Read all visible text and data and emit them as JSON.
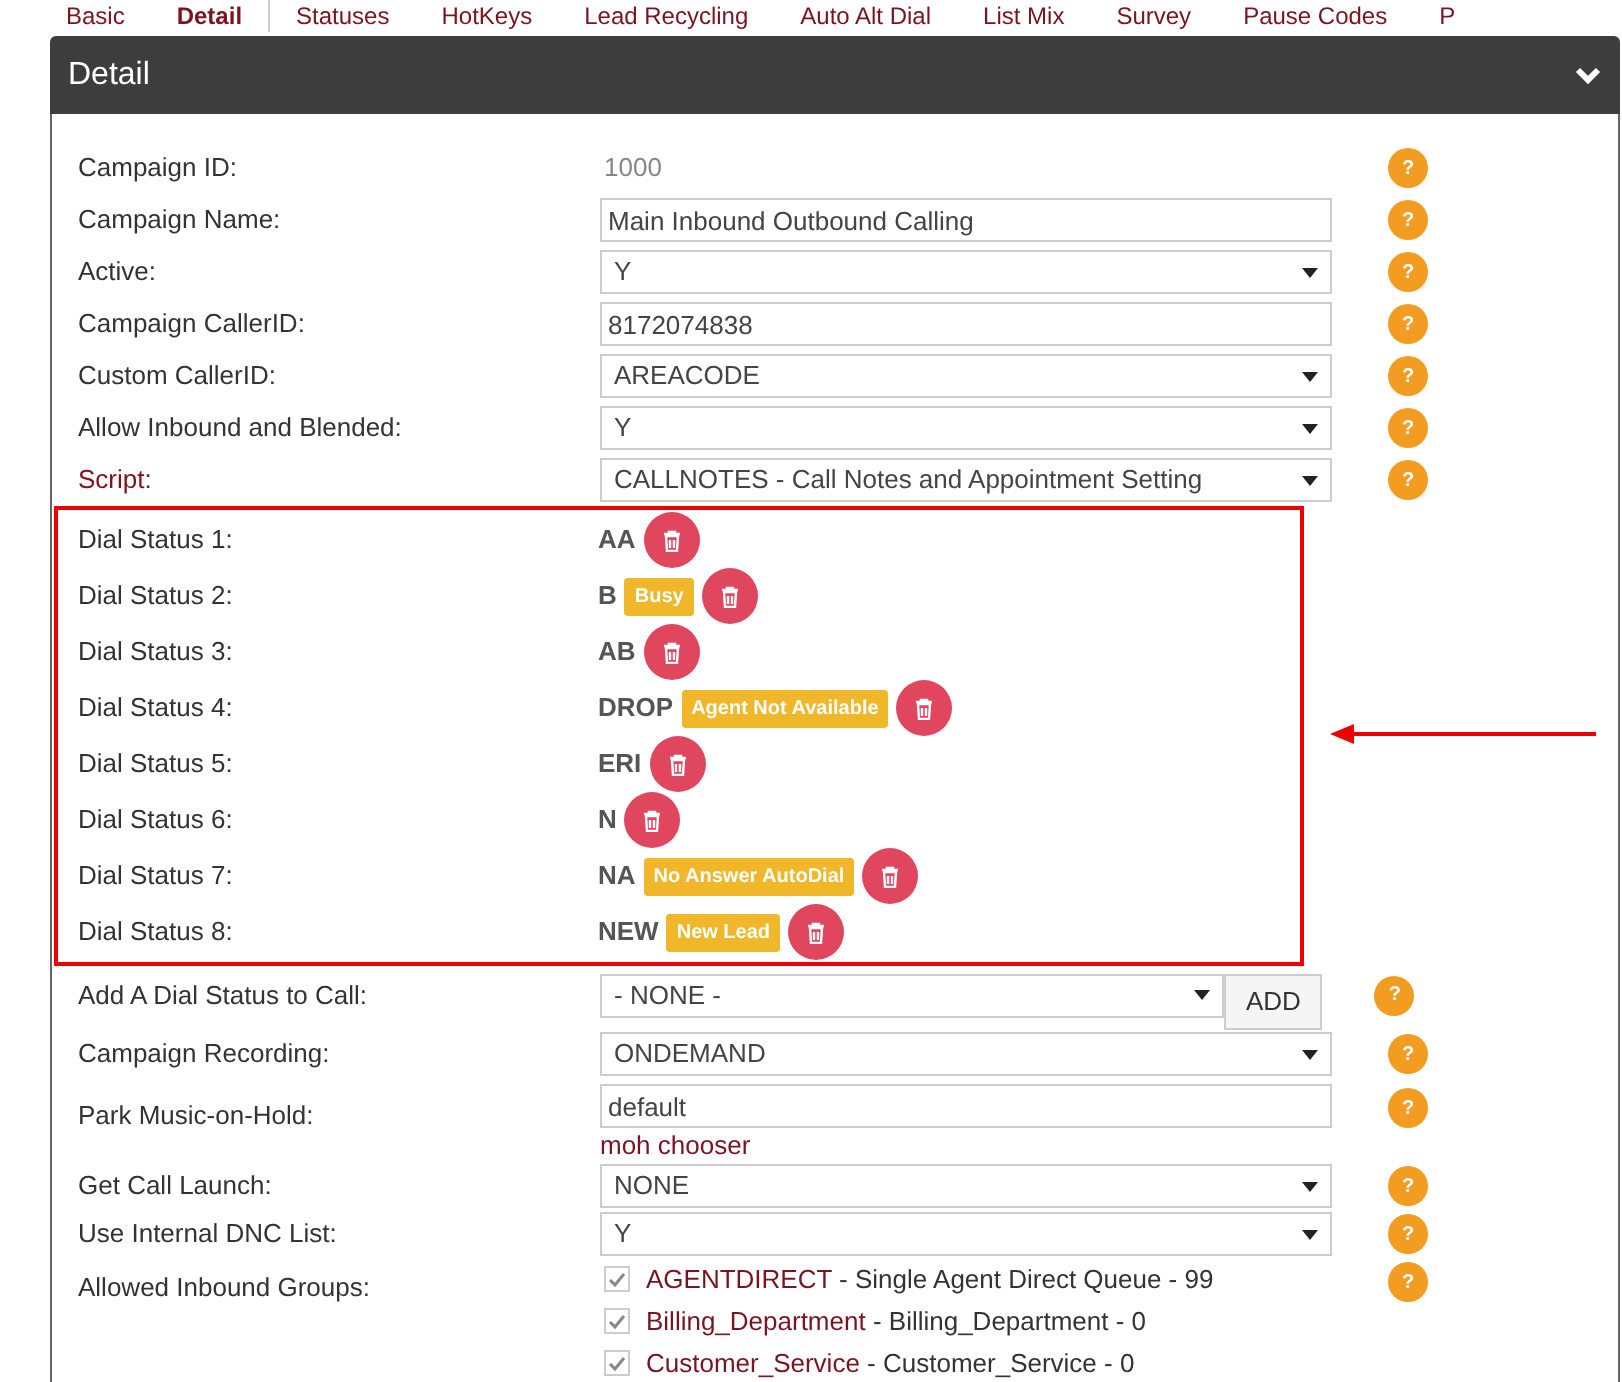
{
  "tabs": [
    {
      "label": "Basic",
      "selected": false
    },
    {
      "label": "Detail",
      "selected": true
    },
    {
      "label": "Statuses",
      "selected": false
    },
    {
      "label": "HotKeys",
      "selected": false
    },
    {
      "label": "Lead Recycling",
      "selected": false
    },
    {
      "label": "Auto Alt Dial",
      "selected": false
    },
    {
      "label": "List Mix",
      "selected": false
    },
    {
      "label": "Survey",
      "selected": false
    },
    {
      "label": "Pause Codes",
      "selected": false
    },
    {
      "label": "P",
      "selected": false
    }
  ],
  "panel": {
    "title": "Detail",
    "expanded": true
  },
  "fields": [
    {
      "kind": "text",
      "label": "Campaign ID:",
      "label_link": false,
      "value": "1000",
      "help": "?"
    },
    {
      "kind": "input",
      "label": "Campaign Name:",
      "label_link": false,
      "value": "Main Inbound Outbound Calling",
      "help": "?"
    },
    {
      "kind": "select",
      "label": "Active:",
      "label_link": false,
      "value": "Y",
      "help": "?"
    },
    {
      "kind": "input",
      "label": "Campaign CallerID:",
      "label_link": false,
      "value": "8172074838",
      "help": "?"
    },
    {
      "kind": "select",
      "label": "Custom CallerID:",
      "label_link": false,
      "value": "AREACODE",
      "help": "?"
    },
    {
      "kind": "select",
      "label": "Allow Inbound and Blended:",
      "label_link": false,
      "value": "Y",
      "help": "?"
    },
    {
      "kind": "select",
      "label": "Script:",
      "label_link": true,
      "value": "CALLNOTES - Call Notes and Appointment Setting",
      "help": "?"
    }
  ],
  "dial_statuses": [
    {
      "label": "Dial Status 1:",
      "code": "AA"
    },
    {
      "label": "Dial Status 2:",
      "code": "B",
      "badge": "Busy"
    },
    {
      "label": "Dial Status 3:",
      "code": "AB"
    },
    {
      "label": "Dial Status 4:",
      "code": "DROP",
      "badge": "Agent Not Available"
    },
    {
      "label": "Dial Status 5:",
      "code": "ERI"
    },
    {
      "label": "Dial Status 6:",
      "code": "N"
    },
    {
      "label": "Dial Status 7:",
      "code": "NA",
      "badge": "No Answer AutoDial"
    },
    {
      "label": "Dial Status 8:",
      "code": "NEW",
      "badge": "New Lead"
    }
  ],
  "more_fields": [
    {
      "kind": "add",
      "label": "Add A Dial Status to Call:",
      "value": "- NONE -",
      "button": "ADD",
      "help": "?"
    },
    {
      "kind": "select",
      "label": "Campaign Recording:",
      "value": "ONDEMAND",
      "help": "?"
    },
    {
      "kind": "input",
      "label": "Park Music-on-Hold:",
      "value": "default",
      "link": "moh chooser",
      "help": "?"
    },
    {
      "kind": "select",
      "label": "Get Call Launch:",
      "value": "NONE",
      "help": "?"
    },
    {
      "kind": "select",
      "label": "Use Internal DNC List:",
      "value": "Y",
      "help": "?"
    },
    {
      "kind": "groups",
      "label": "Allowed Inbound Groups:",
      "help": "?",
      "groups": [
        {
          "code": "AGENTDIRECT",
          "name": " - Single Agent Direct Queue - 99",
          "checked": true
        },
        {
          "code": "Billing_Department",
          "name": " - Billing_Department - 0",
          "checked": true
        },
        {
          "code": "Customer_Service",
          "name": " - Customer_Service - 0",
          "checked": true
        }
      ]
    }
  ]
}
